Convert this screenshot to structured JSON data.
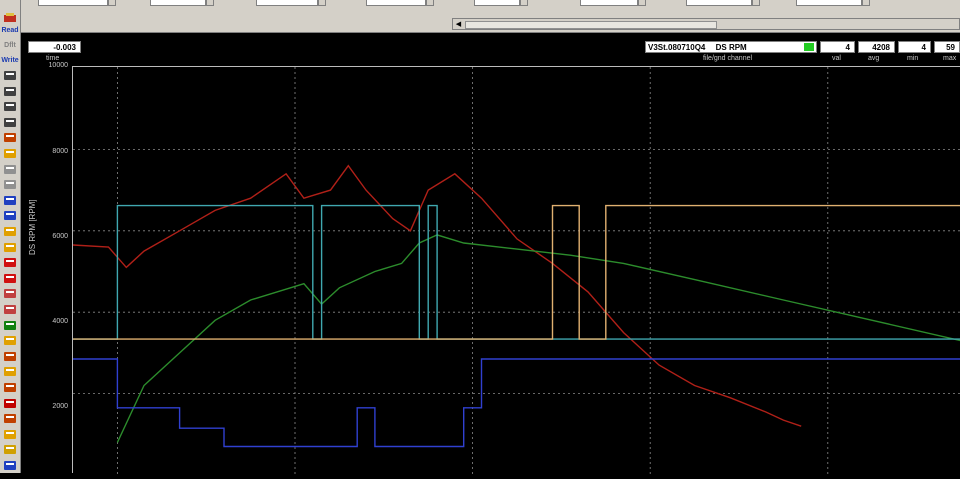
{
  "toolbar": {
    "read_label": "Read",
    "dflt_label": "Dflt",
    "write_label": "Write",
    "tools": [
      "print-icon",
      "copy-icon",
      "document-icon",
      "eraser-icon",
      "data-icon",
      "folder-icon",
      "screen-icon",
      "screen-icon",
      "zoom-in-icon",
      "zoom-out-icon",
      "waveform-icon",
      "waveform-icon",
      "arrow-left-icon",
      "arrow-right-icon",
      "chart-icon",
      "chart-icon",
      "gauge-icon",
      "flame-icon",
      "refresh-icon",
      "flame-icon",
      "refresh-icon",
      "keyboard-icon",
      "refresh-icon",
      "flame-icon",
      "tire-icon",
      "help-icon"
    ]
  },
  "cursor": {
    "time_value": "-0.003",
    "time_label": "time"
  },
  "channel": {
    "file_name": "V3St.080710Q4",
    "channel_name": "DS RPM",
    "file_gnd_label": "file/gnd channel",
    "status_color": "#22cc22"
  },
  "stats": {
    "val": "4",
    "avg": "4208",
    "min": "4",
    "max": "59",
    "val_label": "val",
    "avg_label": "avg",
    "min_label": "min",
    "max_label": "max"
  },
  "axis": {
    "y_label": "DS RPM  [RPM]",
    "y_ticks": [
      "10000",
      "8000",
      "6000",
      "4000",
      "2000"
    ]
  },
  "chart_data": {
    "type": "line",
    "ylabel": "DS RPM  [RPM]",
    "ylim": [
      0,
      10000
    ],
    "grid": true,
    "series": [
      {
        "color": "#b02018",
        "x": [
          0,
          4,
          6,
          8,
          12,
          16,
          20,
          24,
          26,
          29,
          31,
          33,
          36,
          38,
          40,
          43,
          46,
          50,
          54,
          58,
          62,
          66,
          70,
          74,
          78,
          80,
          82
        ],
        "values": [
          5650,
          5600,
          5100,
          5500,
          6000,
          6500,
          6800,
          7400,
          6800,
          7000,
          7600,
          7000,
          6300,
          6000,
          7000,
          7400,
          6800,
          5800,
          5200,
          4500,
          3500,
          2700,
          2200,
          1900,
          1550,
          1350,
          1200
        ]
      },
      {
        "color": "#2c8c2c",
        "x": [
          5,
          8,
          12,
          16,
          20,
          26,
          28,
          30,
          34,
          37,
          39,
          41,
          44,
          50,
          56,
          62,
          70,
          80,
          90,
          100
        ],
        "values": [
          800,
          2200,
          3000,
          3800,
          4300,
          4700,
          4200,
          4600,
          5000,
          5200,
          5700,
          5900,
          5700,
          5550,
          5400,
          5200,
          4800,
          4300,
          3800,
          3300
        ]
      },
      {
        "color": "#40a8b0",
        "x": [
          0,
          5,
          5,
          27,
          27,
          28,
          28,
          39,
          39,
          40,
          40,
          41,
          41,
          100
        ],
        "values": [
          3340,
          3340,
          6620,
          6620,
          3340,
          3340,
          6620,
          6620,
          3340,
          3340,
          6620,
          6620,
          3340,
          3340
        ]
      },
      {
        "color": "#e0b070",
        "x": [
          0,
          54,
          54,
          57,
          57,
          60,
          60,
          100
        ],
        "values": [
          3340,
          3340,
          6620,
          6620,
          3340,
          3340,
          6620,
          6620
        ]
      },
      {
        "color": "#3040d0",
        "x": [
          0,
          5,
          5,
          12,
          12,
          17,
          17,
          32,
          32,
          34,
          34,
          44,
          44,
          46,
          46,
          100
        ],
        "values": [
          2850,
          2850,
          1650,
          1650,
          1150,
          1150,
          700,
          700,
          1650,
          1650,
          700,
          700,
          1650,
          1650,
          2850,
          2850
        ]
      }
    ]
  }
}
